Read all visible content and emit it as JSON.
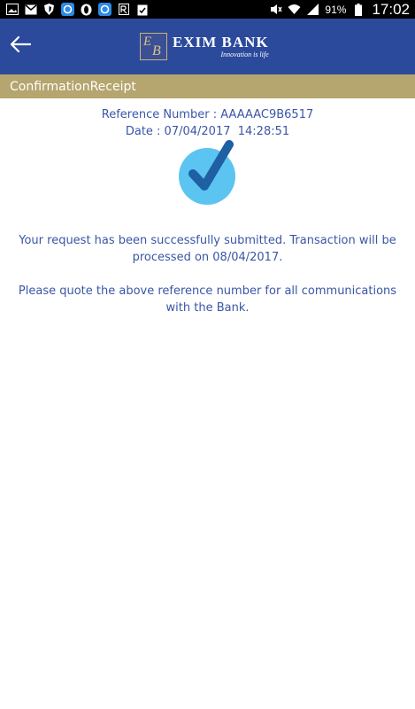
{
  "status_bar": {
    "battery_percent": "91%",
    "time": "17:02"
  },
  "header": {
    "logo_monogram": "EB",
    "logo_name": "EXIM BANK",
    "logo_tagline": "Innovation is life",
    "colors": {
      "background": "#2c4a9c"
    }
  },
  "title_bar": {
    "title": "ConfirmationReceipt",
    "colors": {
      "background": "#b5a56e"
    }
  },
  "receipt": {
    "reference_line": "Reference Number : AAAAAC9B6517",
    "date_line": "Date : 07/04/2017  14:28:51",
    "status_icon": "checkmark-icon",
    "message_submitted": "Your request has been successfully submitted. Transaction will be processed on 08/04/2017.",
    "message_quote": "Please quote the above reference number for all communications with the Bank.",
    "colors": {
      "text": "#3a56a6",
      "check_circle": "#5bc4f1",
      "check_mark": "#1f5fa3"
    }
  }
}
